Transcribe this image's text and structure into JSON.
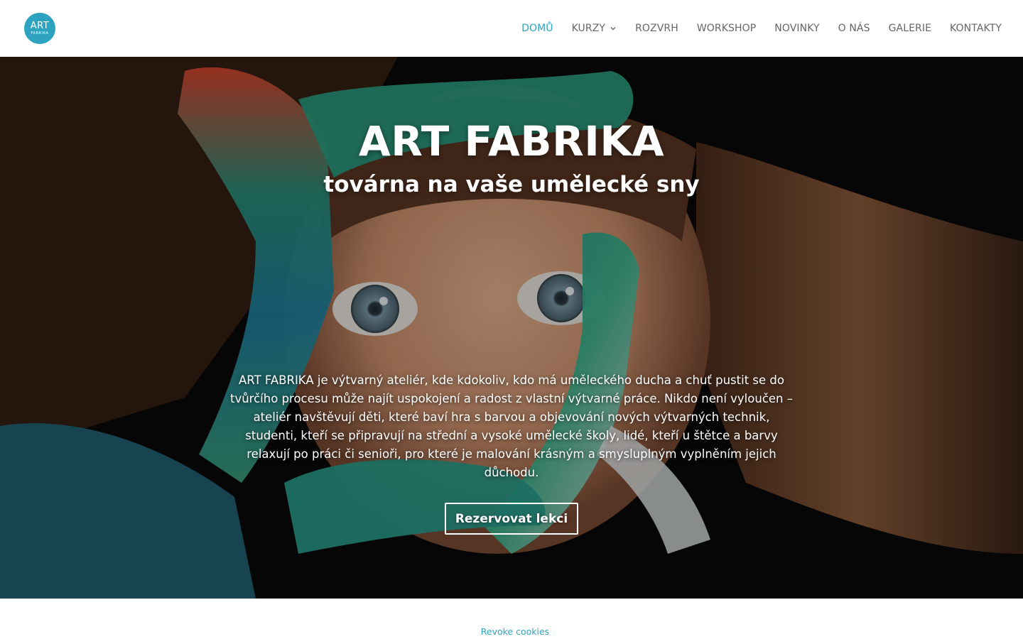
{
  "brand": {
    "logo_main": "ART",
    "logo_sub": "FABRIKA",
    "accent_color": "#2ea3c0"
  },
  "nav": {
    "items": [
      {
        "label": "DOMŮ",
        "active": true
      },
      {
        "label": "KURZY",
        "has_dropdown": true
      },
      {
        "label": "ROZVRH"
      },
      {
        "label": "WORKSHOP"
      },
      {
        "label": "NOVINKY"
      },
      {
        "label": "O NÁS"
      },
      {
        "label": "GALERIE"
      },
      {
        "label": "KONTAKTY"
      }
    ]
  },
  "hero": {
    "title": "ART FABRIKA",
    "subtitle": "továrna na vaše umělecké sny",
    "text": "ART FABRIKA je výtvarný ateliér, kde kdokoliv, kdo má uměleckého ducha a chuť pustit se do tvůrčího procesu může najít uspokojení a radost z vlastní výtvarné práce. Nikdo není vyloučen – ateliér navštěvují děti, které baví hra s barvou a objevování nových výtvarných technik, studenti, kteří se připravují na střední a vysoké umělecké školy, lidé, kteří u štětce a barvy relaxují po práci či senioři, pro které je malování krásným a smysluplným vyplněním jejich důchodu.",
    "button_label": "Rezervovat lekci"
  },
  "footer": {
    "revoke_cookies": "Revoke cookies"
  }
}
